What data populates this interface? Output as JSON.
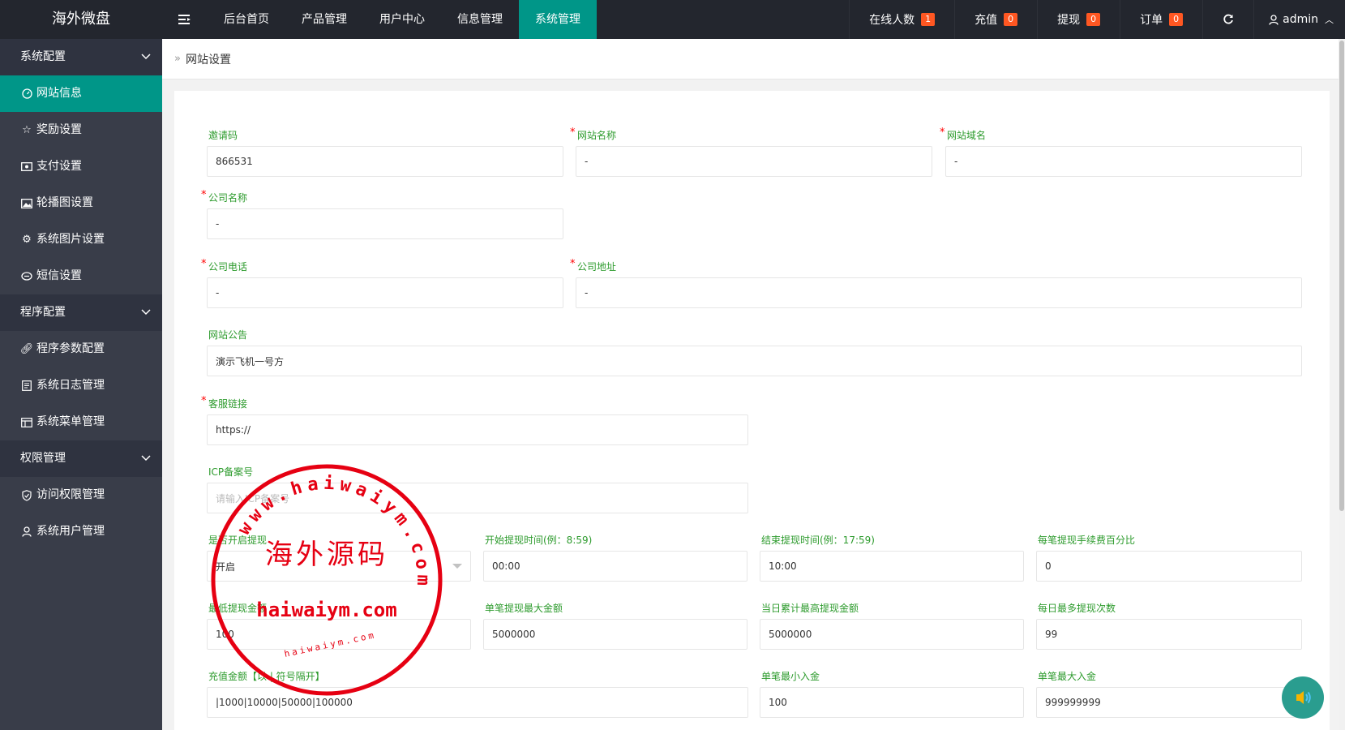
{
  "app": {
    "title": "海外微盘"
  },
  "topnav": {
    "items": [
      {
        "label": "后台首页"
      },
      {
        "label": "产品管理"
      },
      {
        "label": "用户中心"
      },
      {
        "label": "信息管理"
      },
      {
        "label": "系统管理"
      }
    ],
    "active_index": 4
  },
  "rightnav": {
    "online": {
      "label": "在线人数",
      "count": "1"
    },
    "recharge": {
      "label": "充值",
      "count": "0"
    },
    "withdraw": {
      "label": "提现",
      "count": "0"
    },
    "orders": {
      "label": "订单",
      "count": "0"
    },
    "user": {
      "name": "admin"
    }
  },
  "sidebar": {
    "groups": [
      {
        "label": "系统配置"
      },
      {
        "label": "程序配置"
      },
      {
        "label": "权限管理"
      }
    ],
    "items": [
      {
        "label": "网站信息",
        "icon": "dashboard-icon"
      },
      {
        "label": "奖励设置",
        "icon": "star-icon"
      },
      {
        "label": "支付设置",
        "icon": "money-icon"
      },
      {
        "label": "轮播图设置",
        "icon": "image-icon"
      },
      {
        "label": "系统图片设置",
        "icon": "gear-icon"
      },
      {
        "label": "短信设置",
        "icon": "message-icon"
      },
      {
        "label": "程序参数配置",
        "icon": "link-icon"
      },
      {
        "label": "系统日志管理",
        "icon": "log-icon"
      },
      {
        "label": "系统菜单管理",
        "icon": "table-icon"
      },
      {
        "label": "访问权限管理",
        "icon": "shield-icon"
      },
      {
        "label": "系统用户管理",
        "icon": "user-icon"
      }
    ]
  },
  "breadcrumb": {
    "current": "网站设置"
  },
  "form": {
    "invite_code": {
      "label": "邀请码",
      "value": "866531"
    },
    "site_name": {
      "label": "网站名称",
      "value": "-"
    },
    "site_domain": {
      "label": "网站域名",
      "value": "-"
    },
    "company_name": {
      "label": "公司名称",
      "value": "-"
    },
    "company_phone": {
      "label": "公司电话",
      "value": "-"
    },
    "company_address": {
      "label": "公司地址",
      "value": "-"
    },
    "notice": {
      "label": "网站公告",
      "value": "演示飞机一号方"
    },
    "service_link": {
      "label": "客服链接",
      "value": "https://"
    },
    "icp": {
      "label": "ICP备案号",
      "placeholder": "请输入ICP备案号"
    },
    "withdraw_enabled": {
      "label": "是否开启提现",
      "value": "开启"
    },
    "withdraw_start": {
      "label": "开始提现时间(例：8:59)",
      "value": "00:00"
    },
    "withdraw_end": {
      "label": "结束提现时间(例：17:59)",
      "value": "10:00"
    },
    "withdraw_fee": {
      "label": "每笔提现手续费百分比",
      "value": "0"
    },
    "min_withdraw": {
      "label": "最低提现金额",
      "value": "100"
    },
    "max_withdraw": {
      "label": "单笔提现最大金额",
      "value": "5000000"
    },
    "daily_max": {
      "label": "当日累计最高提现金额",
      "value": "5000000"
    },
    "daily_times": {
      "label": "每日最多提现次数",
      "value": "99"
    },
    "recharge_amounts": {
      "label": "充值金额【以 | 符号隔开】",
      "value": "|1000|10000|50000|100000"
    },
    "min_deposit": {
      "label": "单笔最小入金",
      "value": "100"
    },
    "max_deposit": {
      "label": "单笔最大入金",
      "value": "999999999"
    }
  },
  "stamp": {
    "center_text": "海外源码",
    "url_text": "haiwaiym.com",
    "ring_text": "www.haiwaiym.com",
    "small_text": "haiwaiym.com"
  },
  "colors": {
    "accent": "#009688",
    "topbar": "#23262e",
    "sidebar": "#393d49",
    "badge": "#ff5722",
    "label_green": "#2d9b2d",
    "stamp_red": "#e60012"
  }
}
